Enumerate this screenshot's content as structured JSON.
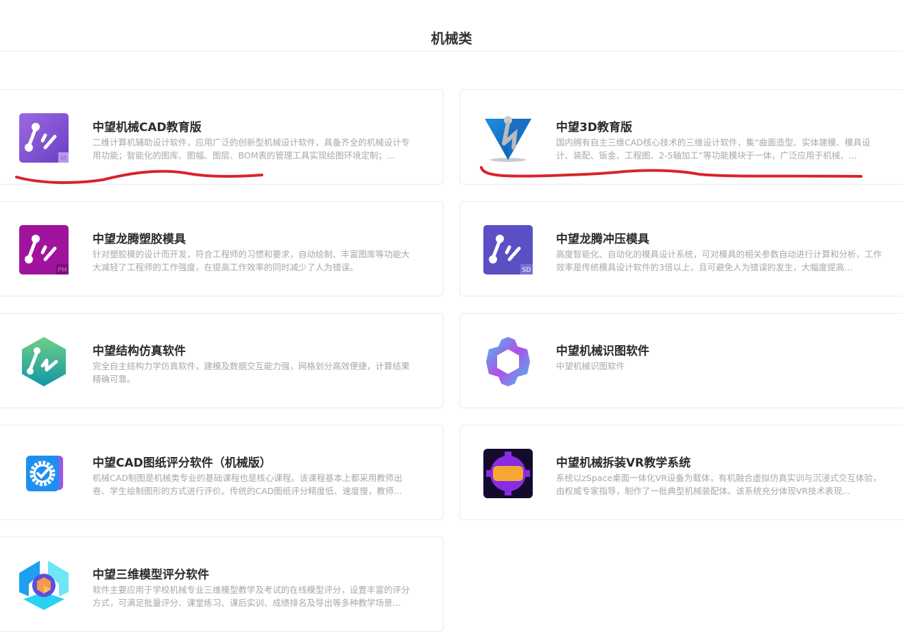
{
  "section": {
    "title": "机械类"
  },
  "products": [
    {
      "title": "中望机械CAD教育版",
      "desc": "二维计算机辅助设计软件，应用广泛的创新型机械设计软件，具备齐全的机械设计专用功能；智能化的图库、图幅、图层、BOM表的管理工具实现绘图环境定制；...",
      "icon": "zwcad-mechanical-icon",
      "badge": "M"
    },
    {
      "title": "中望3D教育版",
      "desc": "国内拥有自主三维CAD核心技术的三维设计软件，集“曲面造型、实体建模、模具设计、装配、钣金、工程图、2-5轴加工”等功能模块于一体，广泛应用于机械、...",
      "icon": "zw3d-icon"
    },
    {
      "title": "中望龙腾塑胶模具",
      "desc": "针对塑胶模的设计而开发，符合工程师的习惯和要求，自动绘制、丰富图库等功能大大减轻了工程师的工作强度，在提高工作效率的同时减少了人为错误。",
      "icon": "plastic-mold-icon",
      "badge": "PM"
    },
    {
      "title": "中望龙腾冲压模具",
      "desc": "高度智能化、自动化的模具设计系统，可对模具的相关参数自动进行计算和分析，工作效率是传统模具设计软件的3倍以上，且可避免人为错误的发生，大幅度提高...",
      "icon": "stamping-die-icon",
      "badge": "SD"
    },
    {
      "title": "中望结构仿真软件",
      "desc": "完全自主结构力学仿真软件，建模及数据交互能力强，网格划分高效便捷，计算结果精确可靠。",
      "icon": "structural-simulation-icon"
    },
    {
      "title": "中望机械识图软件",
      "desc": "中望机械识图软件",
      "icon": "drawing-recognition-icon"
    },
    {
      "title": "中望CAD图纸评分软件（机械版）",
      "desc": "机械CAD制图是机械类专业的基础课程也是核心课程。该课程基本上都采用教师出卷、学生绘制图形的方式进行评价。传统的CAD图纸评分精度低、速度慢，教师...",
      "icon": "drawing-grading-icon"
    },
    {
      "title": "中望机械拆装VR教学系统",
      "desc": "系统以zSpace桌面一体化VR设备为载体，有机融合虚拟仿真实训与沉浸式交互体验，由权威专家指导，制作了一批典型机械装配体。该系统充分体现VR技术表现...",
      "icon": "vr-assembly-icon"
    },
    {
      "title": "中望三维模型评分软件",
      "desc": "软件主要应用于学校机械专业三维模型教学及考试的在线模型评分，设置丰富的评分方式，可满足批量评分、课堂练习、课后实训、成绩排名及导出等多种教学场景...",
      "icon": "3d-model-grading-icon"
    }
  ],
  "colors": {
    "annotation": "#d9232a",
    "title": "#2b2b2b",
    "desc": "#a4a8ad"
  }
}
